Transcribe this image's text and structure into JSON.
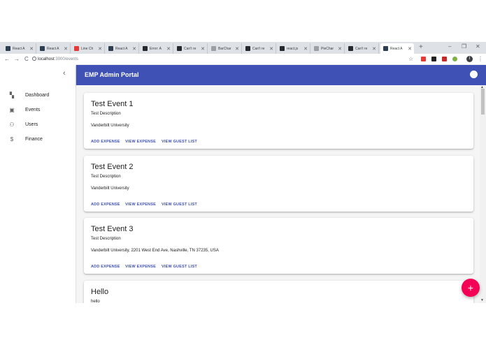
{
  "browser": {
    "tabs": [
      {
        "label": "React A",
        "color": "#2d3e50"
      },
      {
        "label": "React A",
        "color": "#2d3e50"
      },
      {
        "label": "Line Ch",
        "color": "#e53935"
      },
      {
        "label": "React A",
        "color": "#2d3e50"
      },
      {
        "label": "Error: A",
        "color": "#24292e"
      },
      {
        "label": "Can't re",
        "color": "#24292e"
      },
      {
        "label": "BarChar",
        "color": "#9aa0a6"
      },
      {
        "label": "Can't re",
        "color": "#24292e"
      },
      {
        "label": "react.js",
        "color": "#24292e"
      },
      {
        "label": "PieChar",
        "color": "#9aa0a6"
      },
      {
        "label": "Can't re",
        "color": "#24292e"
      },
      {
        "label": "React A",
        "color": "#2d3e50",
        "active": true
      }
    ],
    "new_tab": "+",
    "minimize": "–",
    "maximize": "❐",
    "close": "✕",
    "back": "←",
    "forward": "→",
    "reload": "C",
    "url_host": "localhost",
    "url_path": ":3000/events",
    "star": "☆",
    "profile_initial": "I",
    "menu": "⋮"
  },
  "sidebar": {
    "collapse_icon": "‹",
    "items": [
      {
        "label": "Dashboard",
        "icon": "▚"
      },
      {
        "label": "Events",
        "icon": "▣"
      },
      {
        "label": "Users",
        "icon": "⚇"
      },
      {
        "label": "Finance",
        "icon": "$"
      }
    ]
  },
  "appbar": {
    "title": "EMP Admin Portal"
  },
  "events": [
    {
      "title": "Test Event 1",
      "description": "Test Description",
      "location": "Vanderbilt University"
    },
    {
      "title": "Test Event 2",
      "description": "Test Description",
      "location": "Vanderbilt University"
    },
    {
      "title": "Test Event 3",
      "description": "Test Description",
      "location": "Vanderbilt University, 2201 West End Ave, Nashville, TN 37235, USA"
    },
    {
      "title": "Hello",
      "description": "hello",
      "location": ""
    }
  ],
  "actions": {
    "add_expense": "ADD EXPENSE",
    "view_expense": "VIEW EXPENSE",
    "view_guest_list": "VIEW GUEST LIST"
  },
  "fab": {
    "label": "+"
  },
  "colors": {
    "primary": "#3f51b5",
    "accent": "#f50057"
  }
}
